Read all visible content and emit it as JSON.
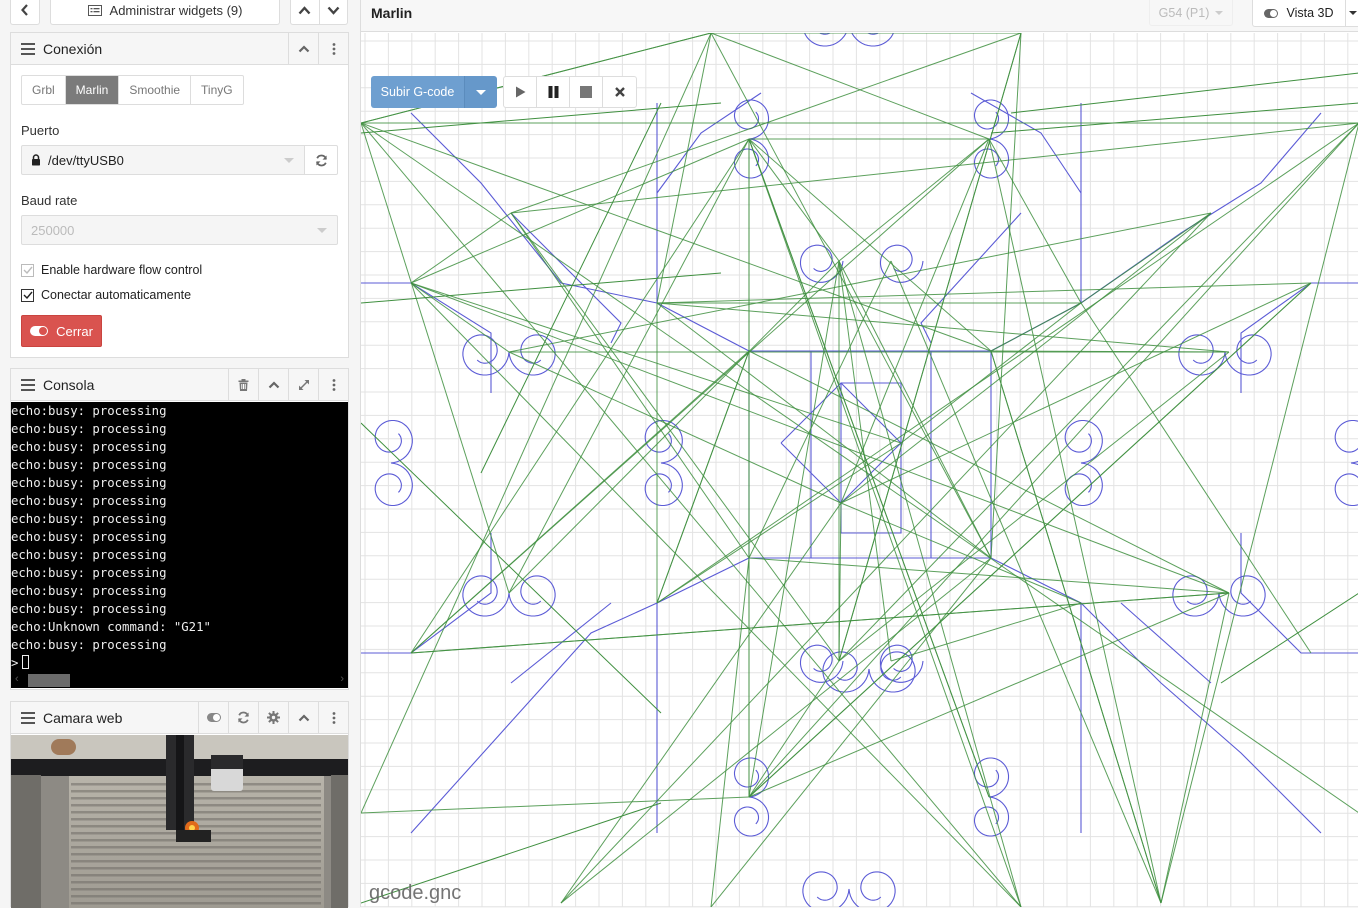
{
  "sidebar": {
    "back_label": "<",
    "manage_widgets_label": "Administrar widgets (9)",
    "connection": {
      "title": "Conexión",
      "controllers": [
        {
          "label": "Grbl",
          "active": false
        },
        {
          "label": "Marlin",
          "active": true
        },
        {
          "label": "Smoothie",
          "active": false
        },
        {
          "label": "TinyG",
          "active": false
        }
      ],
      "port_label": "Puerto",
      "port_value": "/dev/ttyUSB0",
      "baud_label": "Baud rate",
      "baud_value": "250000",
      "hw_flow_label": "Enable hardware flow control",
      "hw_flow_checked": true,
      "auto_connect_label": "Conectar automaticamente",
      "auto_connect_checked": true,
      "close_label": "Cerrar",
      "close_color": "#d9534f"
    },
    "console": {
      "title": "Consola",
      "lines": [
        "echo:busy: processing",
        "echo:busy: processing",
        "echo:busy: processing",
        "echo:busy: processing",
        "echo:busy: processing",
        "echo:busy: processing",
        "echo:busy: processing",
        "echo:busy: processing",
        "echo:busy: processing",
        "echo:busy: processing",
        "echo:busy: processing",
        "echo:busy: processing",
        "echo:Unknown command: \"G21\"",
        "echo:busy: processing"
      ],
      "prompt": ">"
    },
    "camera": {
      "title": "Camara web"
    }
  },
  "main": {
    "title": "Marlin",
    "wcs_label": "G54 (P1)",
    "view3d_label": "Vista 3D",
    "upload_label": "Subir G-code",
    "filename": "gcode.gnc",
    "colors": {
      "cut_path": "#5b5bd6",
      "rapid_path": "#3f8f3f",
      "grid": "#e3e3e3",
      "upload_button": "#6e9fd0"
    }
  }
}
